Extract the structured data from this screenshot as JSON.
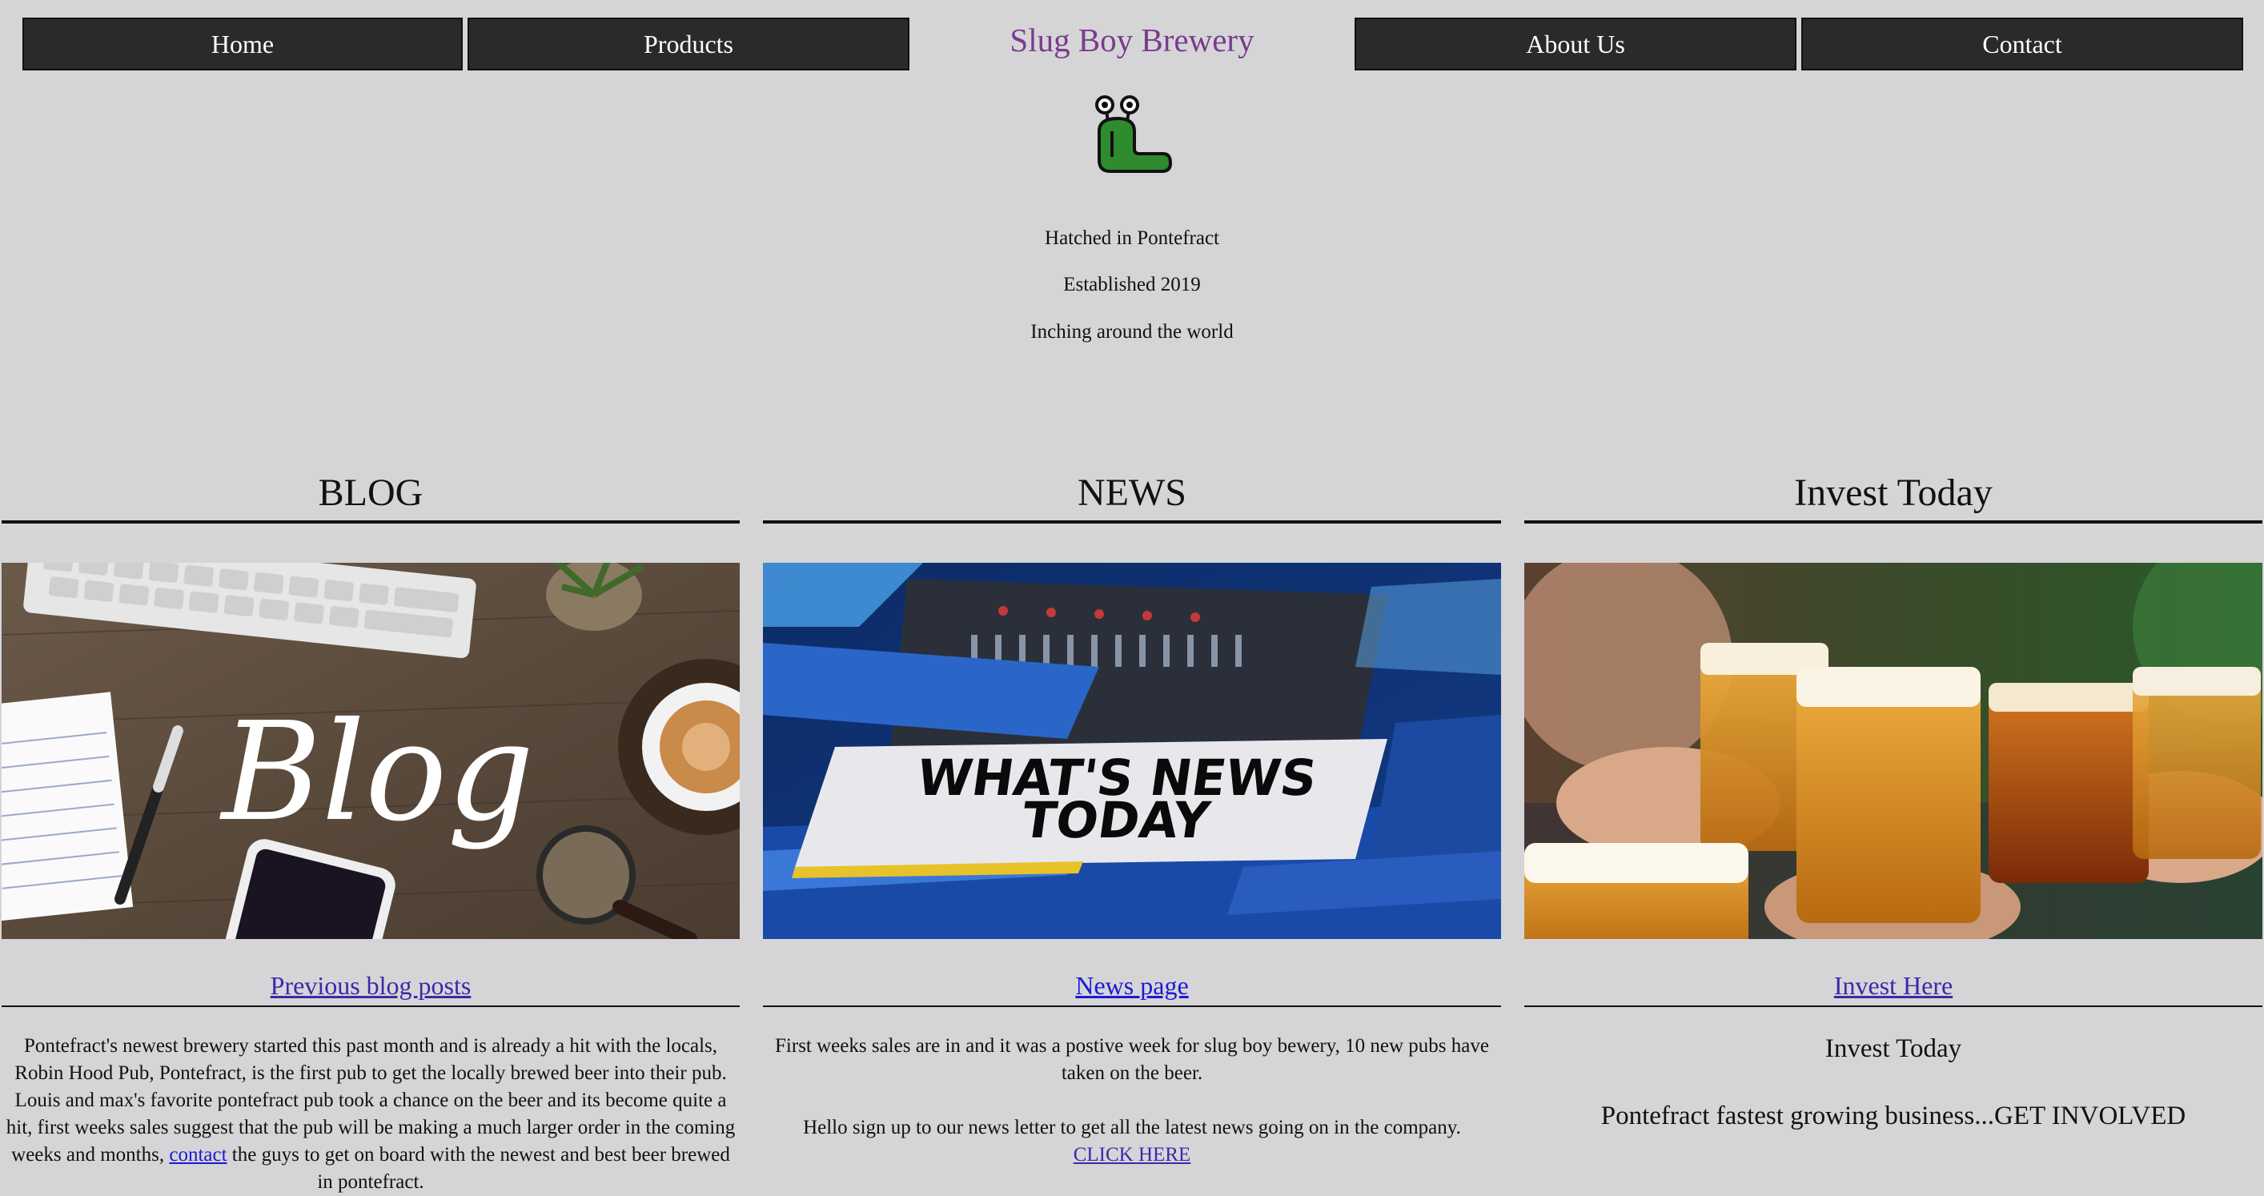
{
  "nav": {
    "home": "Home",
    "products": "Products",
    "about": "About Us",
    "contact": "Contact"
  },
  "brand": {
    "name": "Slug Boy Brewery",
    "logo_icon": "slug-icon"
  },
  "taglines": [
    "Hatched in Pontefract",
    "Established 2019",
    "Inching around the world"
  ],
  "blog": {
    "title": "BLOG",
    "image_text": "Blog",
    "link": "Previous blog posts",
    "text_before": "Pontefract's newest brewery started this past month and is already a hit with the locals, Robin Hood Pub, Pontefract, is the first pub to get the locally brewed beer into their pub. Louis and max's favorite pontefract pub took a chance on the beer and its become quite a hit, first weeks sales suggest that the pub will be making a much larger order in the coming weeks and months,",
    "inline_link": "contact",
    "text_after": "the guys to get on board with the newest and best beer brewed in pontefract."
  },
  "news": {
    "title": "NEWS",
    "image_line1": "WHAT'S NEWS",
    "image_line2": "TODAY",
    "link": "News page",
    "para1": "First weeks sales are in and it was a postive week for slug boy bewery, 10 new pubs have taken on the beer.",
    "para2": "Hello sign up to our news letter to get all the latest news going on in the company.",
    "cta": "CLICK HERE"
  },
  "invest": {
    "title": "Invest Today",
    "link": "Invest Here",
    "subtitle": "Invest Today",
    "slogan": "Pontefract fastest growing business...GET INVOLVED"
  },
  "colors": {
    "background": "#d5d5d8",
    "nav_bg": "#2a2a2a",
    "brand": "#7a3c8c",
    "link": "#3a2aa8"
  }
}
